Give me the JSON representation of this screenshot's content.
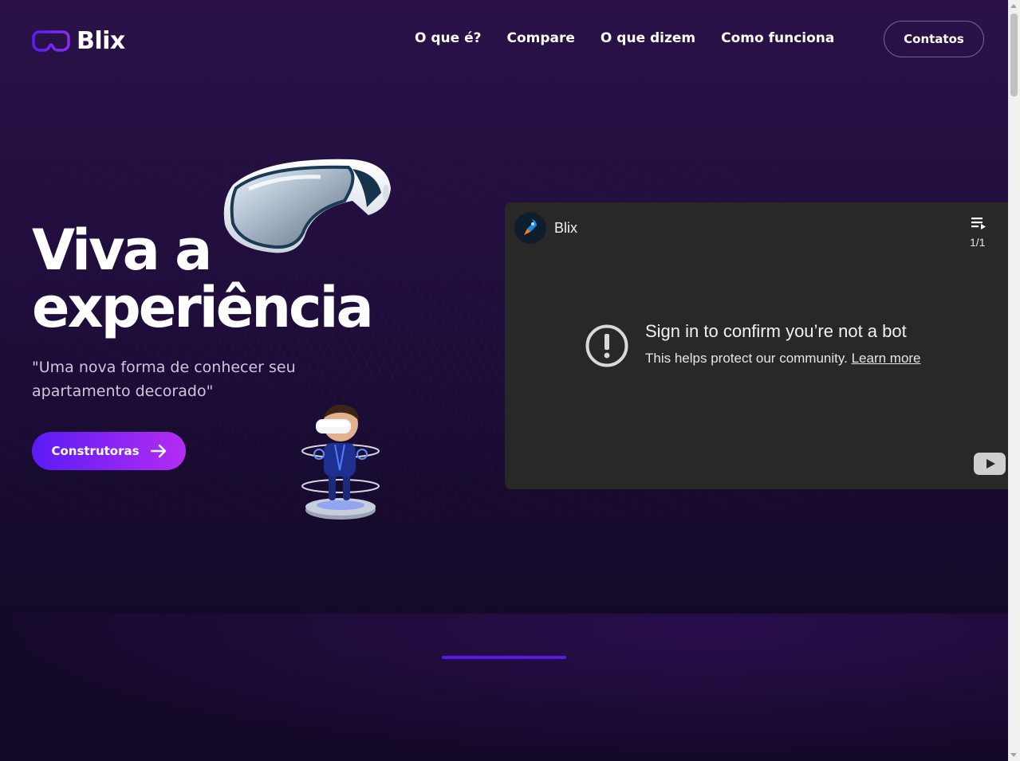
{
  "brand": {
    "name": "Blix",
    "logo_icon": "vr-headset-outline-icon",
    "accent": "#6d2cf5"
  },
  "nav": {
    "items": [
      {
        "label": "O que é?"
      },
      {
        "label": "Compare"
      },
      {
        "label": "O que dizem"
      },
      {
        "label": "Como funciona"
      }
    ],
    "contact_label": "Contatos"
  },
  "hero": {
    "title_line1": "Viva a",
    "title_line2": "experiência",
    "subtitle": "\"Uma nova forma de conhecer seu apartamento decorado\"",
    "cta_label": "Construtoras",
    "cta_icon": "arrow-right-icon",
    "cta_gradient": [
      "#5b1cf5",
      "#b42cf2"
    ]
  },
  "video": {
    "channel_name": "Blix",
    "channel_icon": "rocket-icon",
    "playlist_icon": "playlist-icon",
    "playlist_count": "1/1",
    "message_title": "Sign in to confirm you’re not a bot",
    "message_body": "This helps protect our community.",
    "message_link": "Learn more",
    "alert_icon": "exclamation-circle-icon",
    "player_logo": "youtube-play-icon"
  },
  "slider": {
    "active_color": "#5a18e6"
  }
}
